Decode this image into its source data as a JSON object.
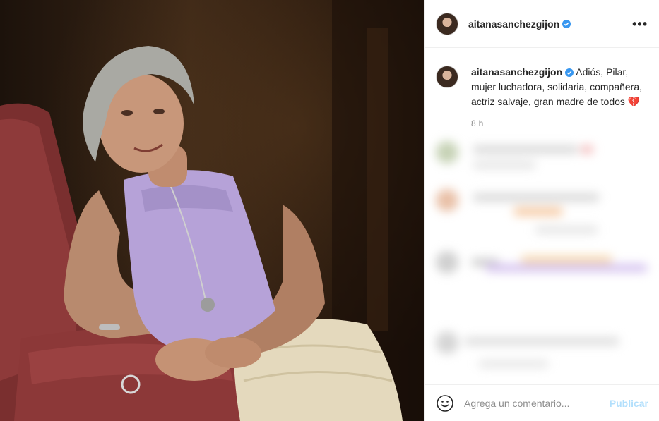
{
  "post": {
    "username": "aitanasanchezgijon",
    "verified_icon": "verified-badge-icon",
    "more_icon": "more-options-icon"
  },
  "caption": {
    "username": "aitanasanchezgijon",
    "text": "Adiós, Pilar, mujer luchadora, solidaria, compañera, actriz salvaje, gran madre de todos 💔",
    "timestamp": "8 h"
  },
  "comment_box": {
    "placeholder": "Agrega un comentario...",
    "publish_label": "Publicar",
    "emoji_icon": "emoji-smiley-icon"
  },
  "colors": {
    "verified_blue": "#3897f0",
    "publish_disabled": "#b2dffc",
    "dress_lilac": "#b6a2d8"
  }
}
